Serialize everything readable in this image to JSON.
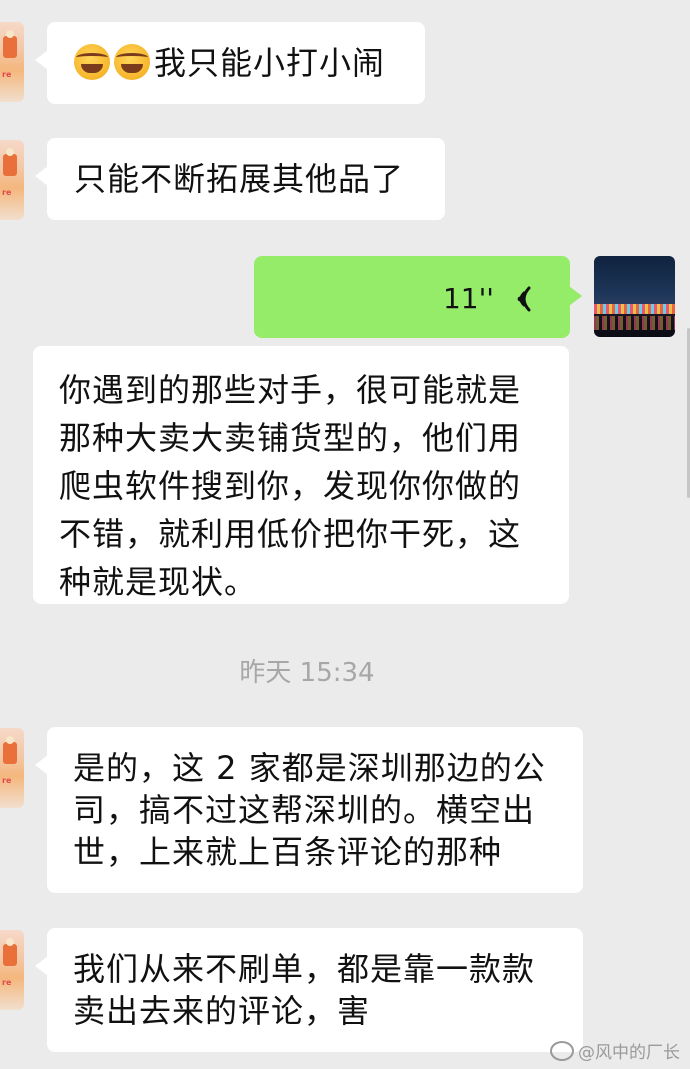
{
  "messages": [
    {
      "side": "left",
      "emoji": [
        "face-with-tears-emoji",
        "face-with-tears-emoji"
      ],
      "lines": [
        "我只能小打小闹"
      ]
    },
    {
      "side": "left",
      "lines": [
        "只能不断拓展其他品了"
      ]
    },
    {
      "side": "right",
      "type": "voice",
      "duration": "11''"
    },
    {
      "side": "left",
      "lines": [
        "你遇到的那些对手，很可能就是",
        "那种大卖大卖铺货型的，他们用",
        "爬虫软件搜到你，发现你你做的",
        "不错，就利用低价把你干死，这",
        "种就是现状。"
      ]
    },
    {
      "side": "left",
      "lines": [
        "是的，这 2 家都是深圳那边的公",
        "司，搞不过这帮深圳的。横空出",
        "世，上来就上百条评论的那种"
      ]
    },
    {
      "side": "left",
      "lines": [
        "我们从来不刷单，都是靠一款款",
        "卖出去来的评论，害"
      ]
    }
  ],
  "timestamp": "昨天 15:34",
  "watermark": "@风中的厂长",
  "colors": {
    "background": "#ebebeb",
    "incoming_bubble": "#ffffff",
    "outgoing_bubble": "#95ec69",
    "timestamp_text": "#a7a7a7"
  }
}
